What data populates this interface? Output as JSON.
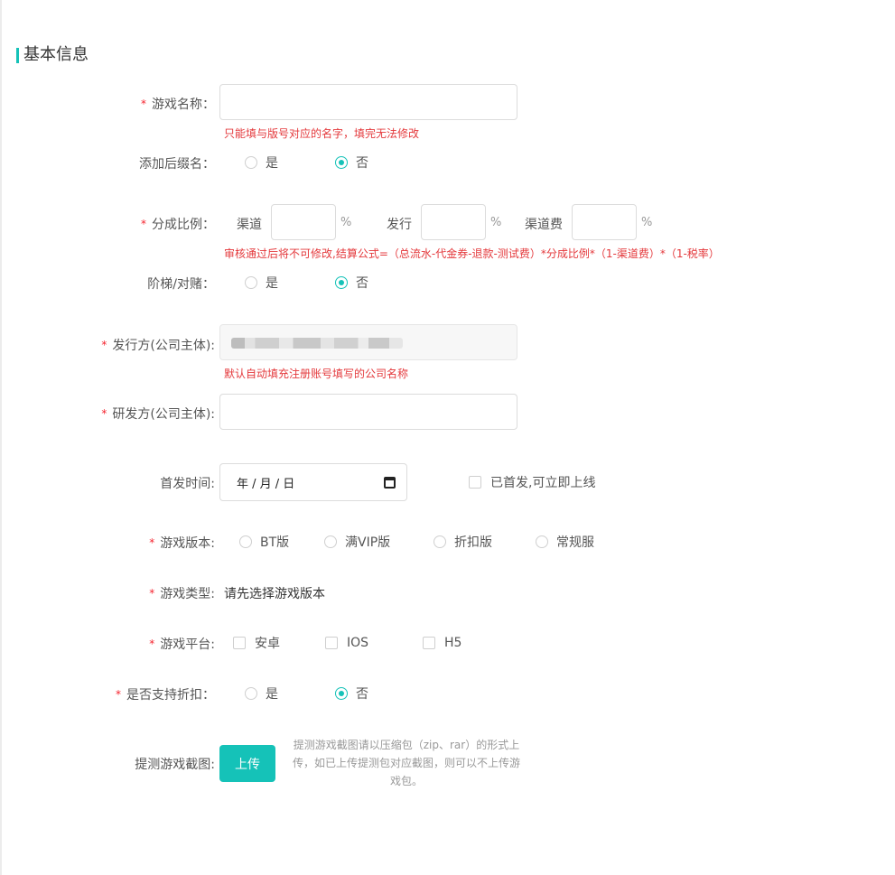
{
  "section": {
    "title": "基本信息"
  },
  "game_name": {
    "label": "游戏名称：",
    "value": "",
    "hint": "只能填与版号对应的名字，填完无法修改"
  },
  "suffix": {
    "label": "添加后缀名：",
    "options": [
      "是",
      "否"
    ],
    "selected": "否"
  },
  "share": {
    "label": "分成比例：",
    "channel_label": "渠道",
    "publish_label": "发行",
    "fee_label": "渠道费",
    "unit": "%",
    "hint": "审核通过后将不可修改,结算公式=（总流水-代金券-退款-测试费）*分成比例*（1-渠道费）*（1-税率）"
  },
  "ladder": {
    "label": "阶梯/对赌：",
    "options": [
      "是",
      "否"
    ],
    "selected": "否"
  },
  "publisher": {
    "label": "发行方(公司主体):",
    "hint": "默认自动填充注册账号填写的公司名称"
  },
  "developer": {
    "label": "研发方(公司主体):",
    "value": ""
  },
  "launch": {
    "label": "首发时间:",
    "date_placeholder": "年 / 月 / 日",
    "checkbox_label": "已首发,可立即上线"
  },
  "version": {
    "label": "游戏版本:",
    "options": [
      "BT版",
      "满VIP版",
      "折扣版",
      "常规服"
    ]
  },
  "type": {
    "label": "游戏类型:",
    "value": "请先选择游戏版本"
  },
  "platform": {
    "label": "游戏平台:",
    "options": [
      "安卓",
      "IOS",
      "H5"
    ]
  },
  "discount": {
    "label": "是否支持折扣：",
    "options": [
      "是",
      "否"
    ],
    "selected": "否"
  },
  "screenshot": {
    "label": "提测游戏截图:",
    "button": "上传",
    "hint": "提测游戏截图请以压缩包（zip、rar）的形式上传，如已上传提测包对应截图，则可以不上传游戏包。"
  },
  "colors": {
    "accent": "#15c2b8",
    "error": "#e4393c",
    "required": "#f5222d"
  }
}
